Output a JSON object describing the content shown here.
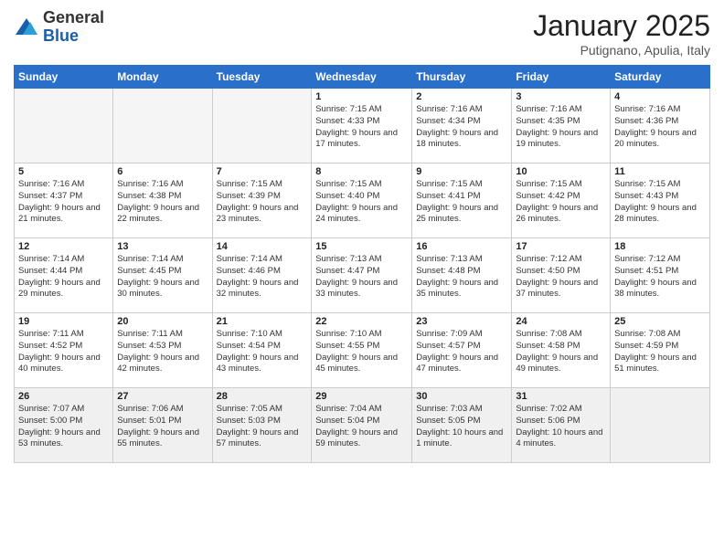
{
  "logo": {
    "general": "General",
    "blue": "Blue"
  },
  "header": {
    "month": "January 2025",
    "location": "Putignano, Apulia, Italy"
  },
  "days_of_week": [
    "Sunday",
    "Monday",
    "Tuesday",
    "Wednesday",
    "Thursday",
    "Friday",
    "Saturday"
  ],
  "weeks": [
    [
      {
        "day": "",
        "info": ""
      },
      {
        "day": "",
        "info": ""
      },
      {
        "day": "",
        "info": ""
      },
      {
        "day": "1",
        "info": "Sunrise: 7:15 AM\nSunset: 4:33 PM\nDaylight: 9 hours\nand 17 minutes."
      },
      {
        "day": "2",
        "info": "Sunrise: 7:16 AM\nSunset: 4:34 PM\nDaylight: 9 hours\nand 18 minutes."
      },
      {
        "day": "3",
        "info": "Sunrise: 7:16 AM\nSunset: 4:35 PM\nDaylight: 9 hours\nand 19 minutes."
      },
      {
        "day": "4",
        "info": "Sunrise: 7:16 AM\nSunset: 4:36 PM\nDaylight: 9 hours\nand 20 minutes."
      }
    ],
    [
      {
        "day": "5",
        "info": "Sunrise: 7:16 AM\nSunset: 4:37 PM\nDaylight: 9 hours\nand 21 minutes."
      },
      {
        "day": "6",
        "info": "Sunrise: 7:16 AM\nSunset: 4:38 PM\nDaylight: 9 hours\nand 22 minutes."
      },
      {
        "day": "7",
        "info": "Sunrise: 7:15 AM\nSunset: 4:39 PM\nDaylight: 9 hours\nand 23 minutes."
      },
      {
        "day": "8",
        "info": "Sunrise: 7:15 AM\nSunset: 4:40 PM\nDaylight: 9 hours\nand 24 minutes."
      },
      {
        "day": "9",
        "info": "Sunrise: 7:15 AM\nSunset: 4:41 PM\nDaylight: 9 hours\nand 25 minutes."
      },
      {
        "day": "10",
        "info": "Sunrise: 7:15 AM\nSunset: 4:42 PM\nDaylight: 9 hours\nand 26 minutes."
      },
      {
        "day": "11",
        "info": "Sunrise: 7:15 AM\nSunset: 4:43 PM\nDaylight: 9 hours\nand 28 minutes."
      }
    ],
    [
      {
        "day": "12",
        "info": "Sunrise: 7:14 AM\nSunset: 4:44 PM\nDaylight: 9 hours\nand 29 minutes."
      },
      {
        "day": "13",
        "info": "Sunrise: 7:14 AM\nSunset: 4:45 PM\nDaylight: 9 hours\nand 30 minutes."
      },
      {
        "day": "14",
        "info": "Sunrise: 7:14 AM\nSunset: 4:46 PM\nDaylight: 9 hours\nand 32 minutes."
      },
      {
        "day": "15",
        "info": "Sunrise: 7:13 AM\nSunset: 4:47 PM\nDaylight: 9 hours\nand 33 minutes."
      },
      {
        "day": "16",
        "info": "Sunrise: 7:13 AM\nSunset: 4:48 PM\nDaylight: 9 hours\nand 35 minutes."
      },
      {
        "day": "17",
        "info": "Sunrise: 7:12 AM\nSunset: 4:50 PM\nDaylight: 9 hours\nand 37 minutes."
      },
      {
        "day": "18",
        "info": "Sunrise: 7:12 AM\nSunset: 4:51 PM\nDaylight: 9 hours\nand 38 minutes."
      }
    ],
    [
      {
        "day": "19",
        "info": "Sunrise: 7:11 AM\nSunset: 4:52 PM\nDaylight: 9 hours\nand 40 minutes."
      },
      {
        "day": "20",
        "info": "Sunrise: 7:11 AM\nSunset: 4:53 PM\nDaylight: 9 hours\nand 42 minutes."
      },
      {
        "day": "21",
        "info": "Sunrise: 7:10 AM\nSunset: 4:54 PM\nDaylight: 9 hours\nand 43 minutes."
      },
      {
        "day": "22",
        "info": "Sunrise: 7:10 AM\nSunset: 4:55 PM\nDaylight: 9 hours\nand 45 minutes."
      },
      {
        "day": "23",
        "info": "Sunrise: 7:09 AM\nSunset: 4:57 PM\nDaylight: 9 hours\nand 47 minutes."
      },
      {
        "day": "24",
        "info": "Sunrise: 7:08 AM\nSunset: 4:58 PM\nDaylight: 9 hours\nand 49 minutes."
      },
      {
        "day": "25",
        "info": "Sunrise: 7:08 AM\nSunset: 4:59 PM\nDaylight: 9 hours\nand 51 minutes."
      }
    ],
    [
      {
        "day": "26",
        "info": "Sunrise: 7:07 AM\nSunset: 5:00 PM\nDaylight: 9 hours\nand 53 minutes."
      },
      {
        "day": "27",
        "info": "Sunrise: 7:06 AM\nSunset: 5:01 PM\nDaylight: 9 hours\nand 55 minutes."
      },
      {
        "day": "28",
        "info": "Sunrise: 7:05 AM\nSunset: 5:03 PM\nDaylight: 9 hours\nand 57 minutes."
      },
      {
        "day": "29",
        "info": "Sunrise: 7:04 AM\nSunset: 5:04 PM\nDaylight: 9 hours\nand 59 minutes."
      },
      {
        "day": "30",
        "info": "Sunrise: 7:03 AM\nSunset: 5:05 PM\nDaylight: 10 hours\nand 1 minute."
      },
      {
        "day": "31",
        "info": "Sunrise: 7:02 AM\nSunset: 5:06 PM\nDaylight: 10 hours\nand 4 minutes."
      },
      {
        "day": "",
        "info": ""
      }
    ]
  ]
}
